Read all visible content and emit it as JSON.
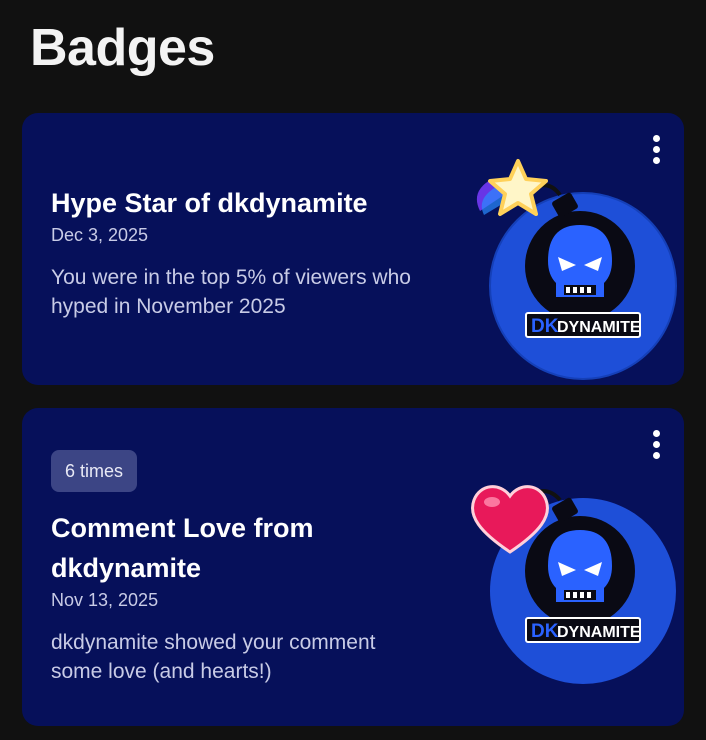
{
  "page": {
    "title": "Badges"
  },
  "badges": [
    {
      "title": "Hype Star of dkdynamite",
      "date": "Dec 3, 2025",
      "description": "You were in the top 5% of viewers who hyped in November 2025",
      "logo_text_left": "DK",
      "logo_text_right": "DYNAMITE",
      "sticker_icon": "star-icon"
    },
    {
      "count_label": "6 times",
      "title": "Comment Love from dkdynamite",
      "date": "Nov 13, 2025",
      "description": "dkdynamite showed your comment some love (and hearts!)",
      "logo_text_left": "DK",
      "logo_text_right": "DYNAMITE",
      "sticker_icon": "heart-icon"
    }
  ],
  "colors": {
    "background": "#111111",
    "card": "#06105a",
    "logo_circle": "#1e4fd8",
    "pill": "#3c4585"
  }
}
